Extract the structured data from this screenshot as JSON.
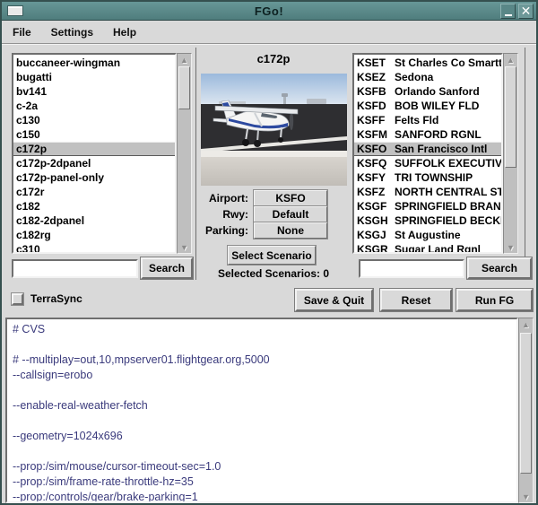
{
  "window": {
    "title": "FGo!"
  },
  "icons": {
    "minimize_icon": "_",
    "close_icon": "✕",
    "scroll_up_icon": "▲",
    "scroll_down_icon": "▼"
  },
  "colors": {
    "titlebar_teal": "#5a8a8a",
    "selection_gray": "#c1c1c1",
    "config_text_blue": "#3a3a7c",
    "background_gray": "#d9d9d9"
  },
  "menu": {
    "items": [
      "File",
      "Settings",
      "Help"
    ]
  },
  "aircraft_panel": {
    "items": [
      "buccaneer-wingman",
      "bugatti",
      "bv141",
      "c-2a",
      "c130",
      "c150",
      "c172p",
      "c172p-2dpanel",
      "c172p-panel-only",
      "c172r",
      "c182",
      "c182-2dpanel",
      "c182rg",
      "c310"
    ],
    "selected": "c172p",
    "search_value": "",
    "search_button_label": "Search"
  },
  "center_panel": {
    "title": "c172p",
    "airport_label": "Airport:",
    "airport_value": "KSFO",
    "rwy_label": "Rwy:",
    "rwy_value": "Default",
    "parking_label": "Parking:",
    "parking_value": "None",
    "select_scenario_label": "Select Scenario",
    "selected_scenarios_label": "Selected Scenarios: 0"
  },
  "airport_panel": {
    "items": [
      {
        "code": "KSET",
        "name": "St Charles Co Smartt"
      },
      {
        "code": "KSEZ",
        "name": "Sedona"
      },
      {
        "code": "KSFB",
        "name": "Orlando Sanford"
      },
      {
        "code": "KSFD",
        "name": "BOB WILEY FLD"
      },
      {
        "code": "KSFF",
        "name": "Felts Fld"
      },
      {
        "code": "KSFM",
        "name": "SANFORD RGNL"
      },
      {
        "code": "KSFO",
        "name": "San Francisco Intl"
      },
      {
        "code": "KSFQ",
        "name": "SUFFOLK EXECUTIVE"
      },
      {
        "code": "KSFY",
        "name": "TRI TOWNSHIP"
      },
      {
        "code": "KSFZ",
        "name": "NORTH CENTRAL STAT"
      },
      {
        "code": "KSGF",
        "name": "SPRINGFIELD BRANSO"
      },
      {
        "code": "KSGH",
        "name": "SPRINGFIELD BECKLE"
      },
      {
        "code": "KSGJ",
        "name": "St Augustine"
      },
      {
        "code": "KSGR",
        "name": "Sugar Land Rgnl"
      }
    ],
    "selected": "KSFO",
    "search_value": "",
    "search_button_label": "Search"
  },
  "action_bar": {
    "terrasync_label": "TerraSync",
    "terrasync_checked": false,
    "save_quit_label": "Save & Quit",
    "reset_label": "Reset",
    "run_fg_label": "Run FG"
  },
  "config_editor": {
    "lines": [
      "# CVS",
      "",
      "# --multiplay=out,10,mpserver01.flightgear.org,5000",
      "--callsign=erobo",
      "",
      "--enable-real-weather-fetch",
      "",
      "--geometry=1024x696",
      "",
      "--prop:/sim/mouse/cursor-timeout-sec=1.0",
      "--prop:/sim/frame-rate-throttle-hz=35",
      "--prop:/controls/gear/brake-parking=1"
    ]
  }
}
